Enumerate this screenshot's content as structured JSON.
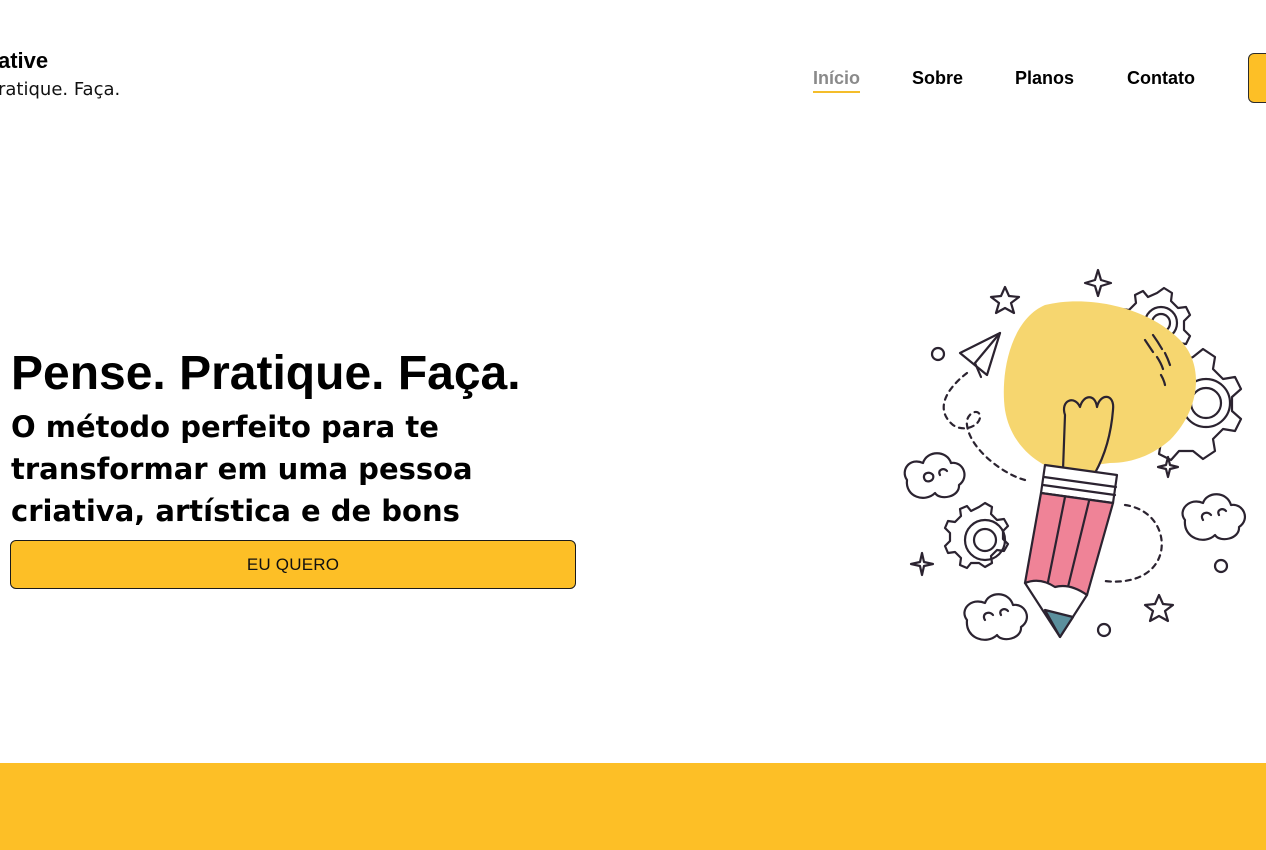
{
  "brand": {
    "name": "ative",
    "tagline": "ratique. Faça."
  },
  "nav": {
    "items": [
      {
        "label": "Início",
        "active": true
      },
      {
        "label": "Sobre",
        "active": false
      },
      {
        "label": "Planos",
        "active": false
      },
      {
        "label": "Contato",
        "active": false
      }
    ]
  },
  "hero": {
    "title": "Pense. Pratique. Faça.",
    "subtitle": "O método perfeito para te transformar em uma pessoa criativa, artística e de bons resultados em todos os setores.",
    "button_label": "EU QUERO"
  },
  "illustration": {
    "icon": "lightbulb-pencil-icon"
  },
  "colors": {
    "accent": "#fdbf26",
    "bulb": "#f6d66f",
    "pencil": "#ef8397",
    "pencil_tip": "#5b8f9d",
    "nav_active": "#8a8a8a"
  }
}
